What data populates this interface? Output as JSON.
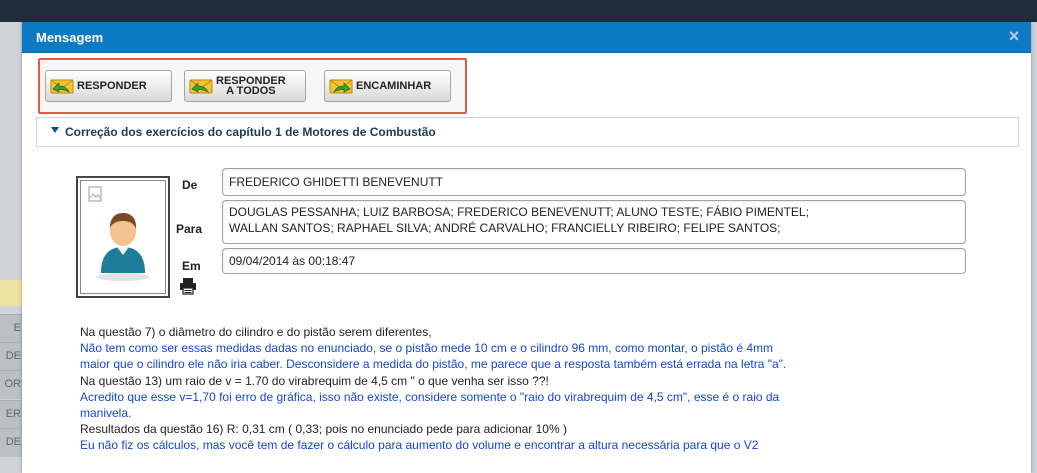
{
  "dialog": {
    "title": "Mensagem",
    "close_icon": "close-icon",
    "toolbar": {
      "reply": "RESPONDER",
      "reply_all_line1": "RESPONDER",
      "reply_all_line2": "A TODOS",
      "forward": "ENCAMINHAR"
    },
    "subject": "Correção dos exercícios do capítulo 1 de Motores de Combustão",
    "header": {
      "from_label": "De",
      "from_value": "FREDERICO GHIDETTI BENEVENUTT",
      "to_label": "Para",
      "to_line1": "DOUGLAS PESSANHA; LUIZ BARBOSA; FREDERICO BENEVENUTT; ALUNO TESTE; FÁBIO PIMENTEL;",
      "to_line2": "WALLAN SANTOS; RAPHAEL SILVA; ANDRÉ CARVALHO; FRANCIELLY RIBEIRO; FELIPE SANTOS;",
      "date_label": "Em",
      "date_value": "09/04/2014 às 00:18:47"
    },
    "body": {
      "l1": "Na questão 7) o diâmetro do cilindro e do pistão serem diferentes,",
      "l2": "Não tem como ser essas medidas dadas no enunciado, se o pistão mede 10 cm e o cilindro 96 mm, como montar, o pistão é 4mm",
      "l3": "maior que o cilindro ele não iria caber. Desconsidere a medida do pistão, me parece que a resposta também está errada na letra \"a\".",
      "l4": "Na questão 13) um raio de v = 1.70 do virabrequim de 4,5 cm \" o que venha ser isso ??!",
      "l5": "Acredito que esse v=1,70 foi erro de gráfica, isso não existe, considere somente o \"raio do virabrequim de 4,5 cm\", esse é o raio da",
      "l6": "manivela.",
      "l7": "Resultados da questão 16) R: 0,31 cm ( 0,33; pois no enunciado pede para adicionar 10% )",
      "l8": "Eu não fiz os cálculos, mas você tem de fazer o cálculo para aumento do volume e encontrar a altura necessária para que o V2"
    },
    "colors": {
      "titlebar": "#0d7bc4",
      "highlight_border": "#e05a45",
      "blue_text": "#1446d6"
    }
  },
  "background": {
    "left_letters": [
      "E",
      "DE",
      "OR",
      "ER",
      "DE"
    ]
  }
}
